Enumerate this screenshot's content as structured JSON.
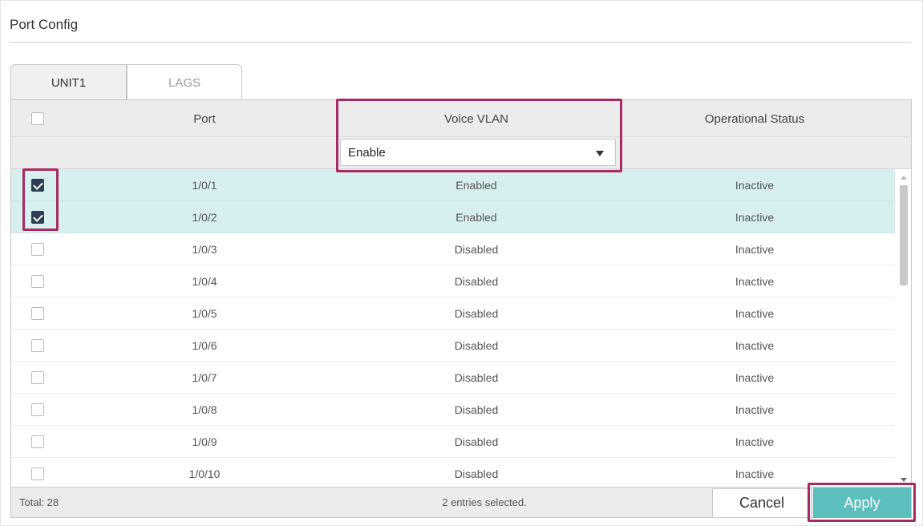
{
  "panel": {
    "title": "Port Config"
  },
  "tabs": [
    {
      "label": "UNIT1",
      "active": true
    },
    {
      "label": "LAGS",
      "active": false
    }
  ],
  "table": {
    "headers": {
      "port": "Port",
      "voice_vlan": "Voice VLAN",
      "status": "Operational Status"
    },
    "filter": {
      "voice_vlan_value": "Enable"
    },
    "rows": [
      {
        "checked": true,
        "port": "1/0/1",
        "voice_vlan": "Enabled",
        "status": "Inactive"
      },
      {
        "checked": true,
        "port": "1/0/2",
        "voice_vlan": "Enabled",
        "status": "Inactive"
      },
      {
        "checked": false,
        "port": "1/0/3",
        "voice_vlan": "Disabled",
        "status": "Inactive"
      },
      {
        "checked": false,
        "port": "1/0/4",
        "voice_vlan": "Disabled",
        "status": "Inactive"
      },
      {
        "checked": false,
        "port": "1/0/5",
        "voice_vlan": "Disabled",
        "status": "Inactive"
      },
      {
        "checked": false,
        "port": "1/0/6",
        "voice_vlan": "Disabled",
        "status": "Inactive"
      },
      {
        "checked": false,
        "port": "1/0/7",
        "voice_vlan": "Disabled",
        "status": "Inactive"
      },
      {
        "checked": false,
        "port": "1/0/8",
        "voice_vlan": "Disabled",
        "status": "Inactive"
      },
      {
        "checked": false,
        "port": "1/0/9",
        "voice_vlan": "Disabled",
        "status": "Inactive"
      },
      {
        "checked": false,
        "port": "1/0/10",
        "voice_vlan": "Disabled",
        "status": "Inactive"
      }
    ]
  },
  "footer": {
    "total": "Total: 28",
    "selected": "2 entries selected.",
    "cancel_label": "Cancel",
    "apply_label": "Apply"
  },
  "colors": {
    "accent": "#5cbfbd",
    "selected_row": "#d7efee",
    "highlight": "#a82a62",
    "checkbox_checked": "#2c3e50"
  },
  "icons": {
    "dropdown": "chevron-down-icon",
    "checkbox": "checkbox-icon"
  }
}
